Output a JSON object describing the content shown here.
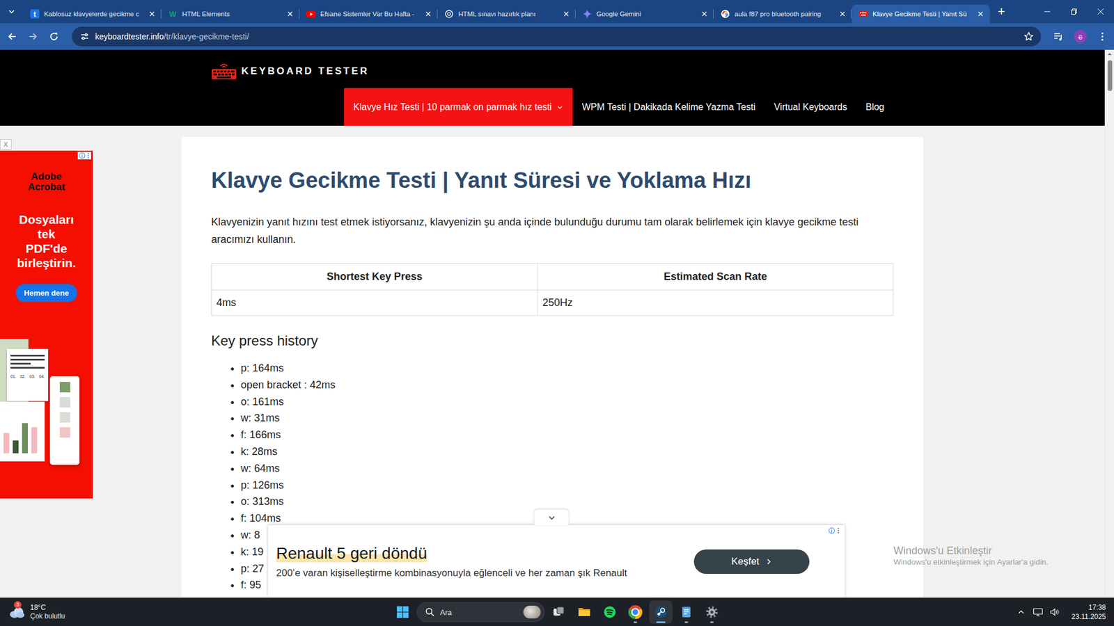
{
  "browser": {
    "tabs": [
      {
        "label": "Kablosuz klavyelerde gecikme c",
        "kind": "tumblr",
        "glyph": "t",
        "selected": false
      },
      {
        "label": "HTML Elements",
        "kind": "w3",
        "glyph": "W",
        "selected": false
      },
      {
        "label": "Efsane Sistemler Var Bu Hafta -",
        "kind": "youtube",
        "selected": false
      },
      {
        "label": "HTML sınavı hazırlık planı",
        "kind": "chatgpt",
        "selected": false
      },
      {
        "label": "Google Gemini",
        "kind": "gemini",
        "selected": false
      },
      {
        "label": "aula f87 pro bluetooth pairing",
        "kind": "google",
        "selected": false
      },
      {
        "label": "Klavye Gecikme Testi | Yanıt Sü",
        "kind": "keyboard",
        "selected": true
      }
    ],
    "new_tab": "+",
    "address": {
      "domain": "keyboardtester.info",
      "path": "/tr/klavye-gecikme-testi/"
    },
    "profile": "e"
  },
  "site": {
    "logo": "KEYBOARD TESTER",
    "nav": [
      {
        "label": "Klavye Hız Testi | 10 parmak on parmak hız testi",
        "selected": true,
        "has_submenu": true
      },
      {
        "label": "WPM Testi | Dakikada Kelime Yazma Testi",
        "selected": false,
        "has_submenu": false
      },
      {
        "label": "Virtual Keyboards",
        "selected": false,
        "has_submenu": false
      },
      {
        "label": "Blog",
        "selected": false,
        "has_submenu": false
      }
    ]
  },
  "page": {
    "title": "Klavye Gecikme Testi | Yanıt Süresi ve Yoklama Hızı",
    "intro": "Klavyenizin yanıt hızını test etmek istiyorsanız, klavyenizin şu anda içinde bulunduğu durumu tam olarak belirlemek için klavye gecikme testi aracımızı kullanın.",
    "stats": {
      "columns": [
        "Shortest Key Press",
        "Estimated Scan Rate"
      ],
      "rows": [
        [
          "4ms",
          "250Hz"
        ]
      ]
    },
    "history_title": "Key press history",
    "history": [
      "p: 164ms",
      "open bracket : 42ms",
      "o: 161ms",
      "w: 31ms",
      "f: 166ms",
      "k: 28ms",
      "w: 64ms",
      "p: 126ms",
      "o: 313ms",
      "f: 104ms",
      "w: 8",
      "k: 19",
      "p: 27",
      "f: 95"
    ]
  },
  "ads": {
    "side": {
      "close": "X",
      "brand": [
        "Adobe",
        "Acrobat"
      ],
      "headline": [
        "Dosyaları",
        "tek",
        "PDF'de",
        "birleştirin."
      ],
      "button": "Hemen dene",
      "doc_labels": [
        "01.",
        "02.",
        "03.",
        "04."
      ]
    },
    "bottom": {
      "title": "Renault 5 geri döndü",
      "text": "200’e varan kişiselleştirme kombinasyonuyla eğlenceli ve her zaman şık Renault",
      "button": "Keşfet"
    }
  },
  "watermark": {
    "title": "Windows'u Etkinleştir",
    "text": "Windows'u etkinleştirmek için Ayarlar'a gidin."
  },
  "taskbar": {
    "weather": {
      "badge": "3",
      "temp": "18°C",
      "condition": "Çok bulutlu"
    },
    "search": "Ara",
    "apps": [
      {
        "kind": "task-view",
        "running": false,
        "active": false
      },
      {
        "kind": "explorer",
        "running": false,
        "active": false
      },
      {
        "kind": "spotify",
        "running": false,
        "active": false
      },
      {
        "kind": "chrome",
        "running": true,
        "active": false
      },
      {
        "kind": "steam",
        "running": true,
        "active": true
      },
      {
        "kind": "notepad",
        "running": true,
        "active": false
      },
      {
        "kind": "settings",
        "running": true,
        "active": false
      }
    ],
    "clock": {
      "time": "17:38",
      "date": "23.11.2025"
    }
  }
}
